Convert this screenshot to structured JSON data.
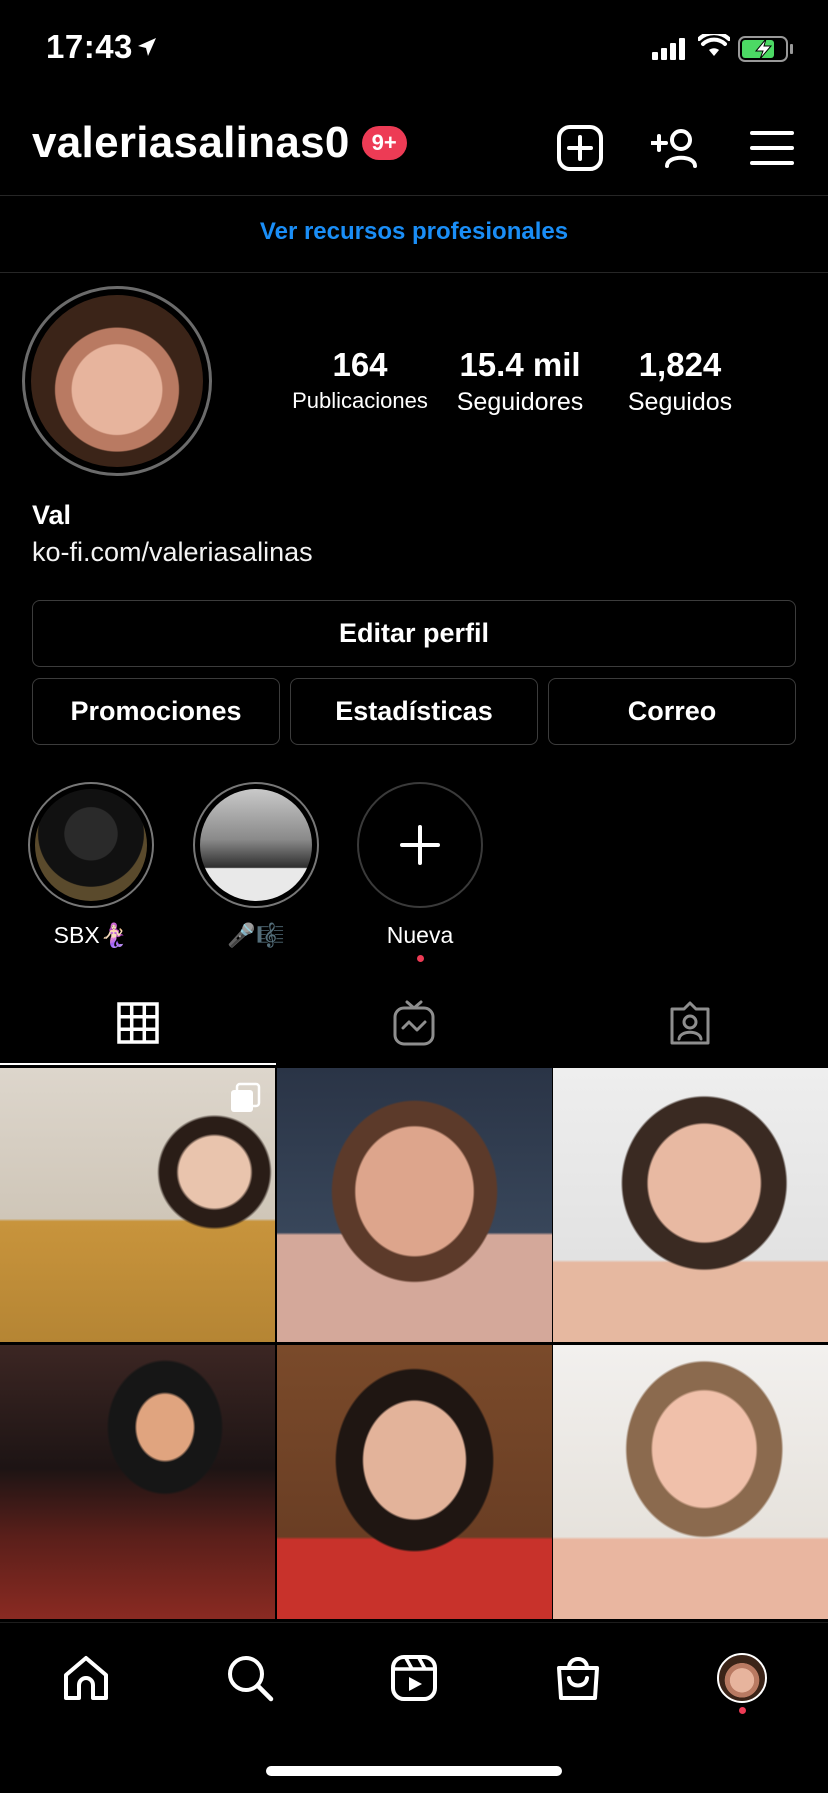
{
  "status_bar": {
    "time": "17:43"
  },
  "header": {
    "username": "valeriasalinas0",
    "badge": "9+"
  },
  "pro_link": "Ver recursos profesionales",
  "stats": [
    {
      "value": "164",
      "label": "Publicaciones"
    },
    {
      "value": "15.4 mil",
      "label": "Seguidores"
    },
    {
      "value": "1,824",
      "label": "Seguidos"
    }
  ],
  "profile": {
    "name": "Val",
    "link": "ko-fi.com/valeriasalinas"
  },
  "buttons": {
    "edit_profile": "Editar perfil",
    "promotions": "Promociones",
    "insights": "Estadísticas",
    "email": "Correo"
  },
  "highlights": [
    {
      "label": "SBX🧜🏻‍♀️"
    },
    {
      "label": "🎤🎼"
    },
    {
      "label": "Nueva"
    }
  ],
  "colors": {
    "accent_blue": "#1a8ef7",
    "badge_red": "#ed3b55",
    "battery_green": "#4cd964"
  }
}
